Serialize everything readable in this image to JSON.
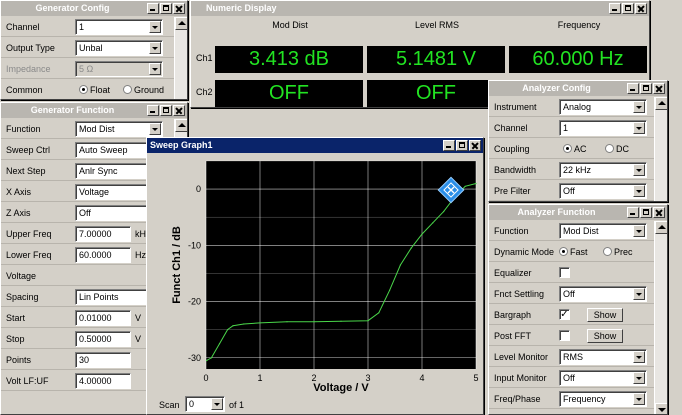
{
  "gen_config": {
    "title": "Generator Config",
    "rows": [
      {
        "label": "Channel",
        "value": "1",
        "disabled": false
      },
      {
        "label": "Output Type",
        "value": "Unbal",
        "disabled": false
      },
      {
        "label": "Impedance",
        "value": "5 Ω",
        "disabled": true
      }
    ],
    "common_label": "Common",
    "common_opt1": "Float",
    "common_opt2": "Ground"
  },
  "gen_function": {
    "title": "Generator Function",
    "function_label": "Function",
    "function_value": "Mod Dist",
    "sweep_label": "Sweep Ctrl",
    "sweep_value": "Auto Sweep",
    "next_label": "Next Step",
    "next_value": "Anlr Sync",
    "xaxis_label": "X Axis",
    "xaxis_value": "Voltage",
    "zaxis_label": "Z Axis",
    "zaxis_value": "Off",
    "upper_label": "Upper Freq",
    "upper_value": "7.00000",
    "upper_unit": "kH",
    "lower_label": "Lower Freq",
    "lower_value": "60.0000",
    "lower_unit": "Hz",
    "section_voltage": "Voltage",
    "spacing_label": "Spacing",
    "spacing_value": "Lin Points",
    "start_label": "Start",
    "start_value": "0.01000",
    "start_unit": "V",
    "stop_label": "Stop",
    "stop_value": "0.50000",
    "stop_unit": "V",
    "points_label": "Points",
    "points_value": "30",
    "volt_label": "Volt LF:UF",
    "volt_value": "4.00000"
  },
  "numeric": {
    "title": "Numeric Display",
    "headers": [
      "Mod Dist",
      "Level RMS",
      "Frequency"
    ],
    "ch1_label": "Ch1",
    "ch2_label": "Ch2",
    "ch1_values": [
      "3.413 dB",
      "5.1481 V",
      "60.000 Hz"
    ],
    "ch2_values": [
      "OFF",
      "OFF"
    ]
  },
  "an_config": {
    "title": "Analyzer Config",
    "instrument_label": "Instrument",
    "instrument_value": "Analog",
    "channel_label": "Channel",
    "channel_value": "1",
    "coupling_label": "Coupling",
    "coupling_opt1": "AC",
    "coupling_opt2": "DC",
    "bandwidth_label": "Bandwidth",
    "bandwidth_value": "22 kHz",
    "prefilter_label": "Pre Filter",
    "prefilter_value": "Off"
  },
  "an_function": {
    "title": "Analyzer Function",
    "function_label": "Function",
    "function_value": "Mod Dist",
    "dynmode_label": "Dynamic Mode",
    "dynmode_opt1": "Fast",
    "dynmode_opt2": "Prec",
    "equalizer_label": "Equalizer",
    "fnct_label": "Fnct Settling",
    "fnct_value": "Off",
    "bargraph_label": "Bargraph",
    "bargraph_btn": "Show",
    "postfft_label": "Post FFT",
    "postfft_btn": "Show",
    "levelmon_label": "Level Monitor",
    "levelmon_value": "RMS",
    "inputmon_label": "Input Monitor",
    "inputmon_value": "Off",
    "freqphase_label": "Freq/Phase",
    "freqphase_value": "Frequency"
  },
  "sweep_graph": {
    "title": "Sweep Graph1",
    "scan_label": "Scan",
    "scan_value": "0",
    "of_label": "of 1",
    "colors": {
      "trace": "#4ad64a",
      "grid": "#ffffff",
      "plot_bg": "#000000",
      "marker": "#2a8ee8"
    }
  },
  "chart_data": {
    "type": "line",
    "title": "",
    "xlabel": "Voltage / V",
    "ylabel": "Funct Ch1 / dB",
    "xlim": [
      0,
      5
    ],
    "ylim": [
      -32,
      5
    ],
    "xticks": [
      0,
      1,
      2,
      3,
      4,
      5
    ],
    "yticks": [
      0,
      -10,
      -20,
      -30
    ],
    "grid": true,
    "series": [
      {
        "x": [
          0.01,
          0.1,
          0.25,
          0.4,
          0.5,
          0.7,
          1.0,
          1.5,
          2.0,
          2.5,
          3.0,
          3.2,
          3.4,
          3.6,
          3.8,
          4.0,
          4.2,
          4.4,
          4.6,
          4.8,
          5.0
        ],
        "y": [
          -30.5,
          -30.0,
          -27.5,
          -25.0,
          -24.3,
          -24.0,
          -23.8,
          -23.6,
          -23.6,
          -23.5,
          -23.4,
          -22.0,
          -18.0,
          -13.5,
          -10.5,
          -8.0,
          -6.0,
          -4.0,
          -1.5,
          0.5,
          1.0
        ]
      }
    ]
  }
}
